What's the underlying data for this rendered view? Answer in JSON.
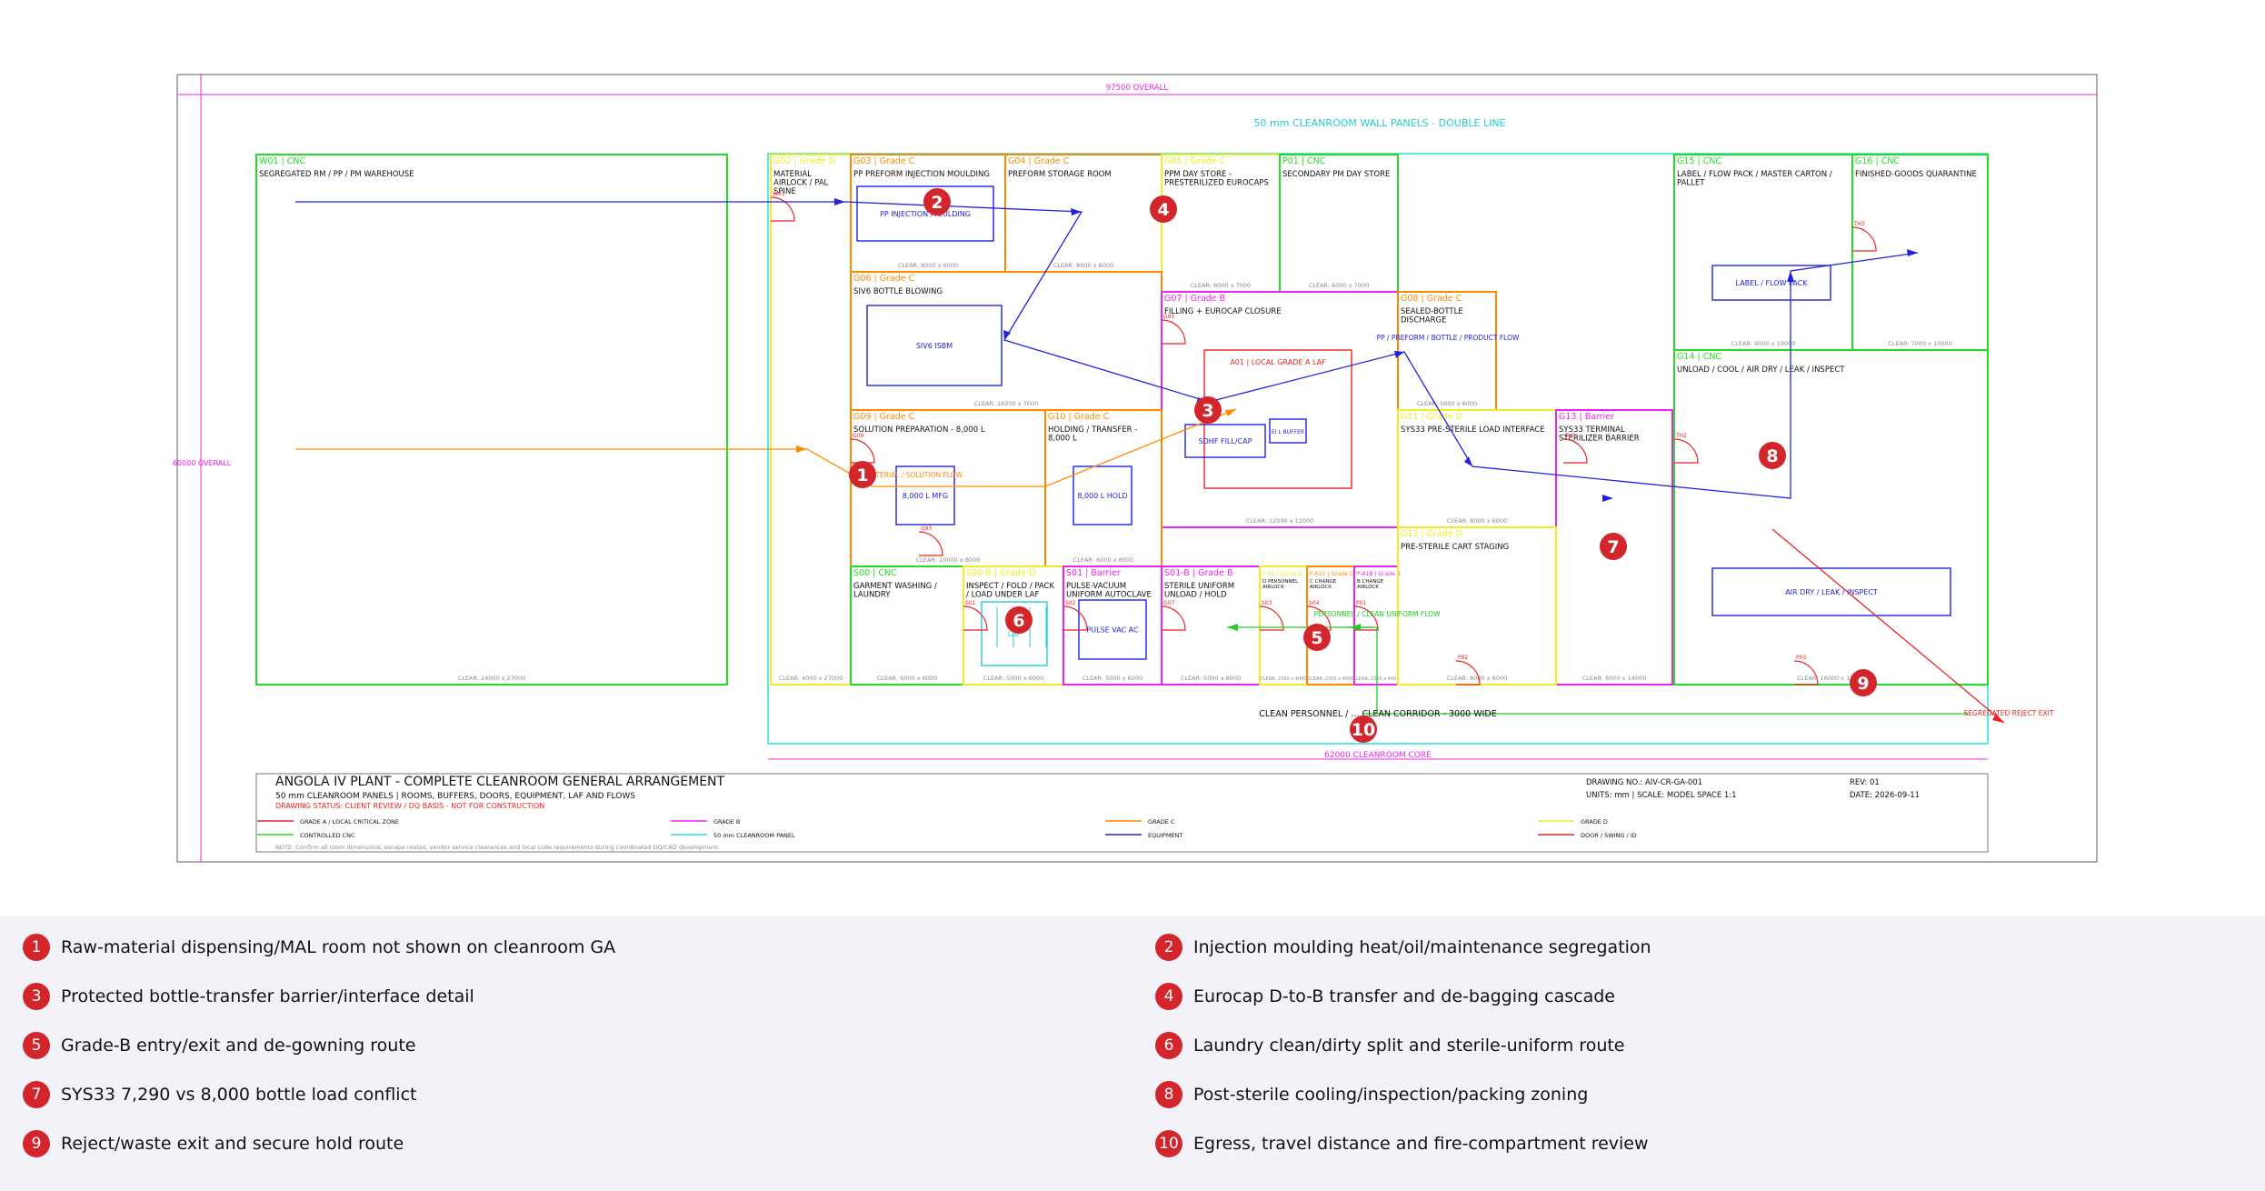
{
  "drawing": {
    "dimensions": {
      "overall_width": "97500 OVERALL",
      "overall_height": "60000 OVERALL",
      "core": "62000 CLEANROOM CORE"
    },
    "wall_panels_label": "50 mm CLEANROOM WALL PANELS - DOUBLE LINE",
    "rooms": [
      {
        "id": "W01",
        "head": "W01 | CNC",
        "name": [
          "SEGREGATED RM / PP / PM WAREHOUSE"
        ],
        "clear": "CLEAR: 24000 x 27000",
        "color": "#22dd22"
      },
      {
        "id": "MAL",
        "head": "G02 | Grade D",
        "name": [
          "MATERIAL",
          "AIRLOCK / PAL",
          "SPINE"
        ],
        "clear": "CLEAR: 4000 x 27000",
        "color": "#eeee22"
      },
      {
        "id": "G03",
        "head": "G03 | Grade C",
        "name": [
          "PP PREFORM INJECTION MOULDING"
        ],
        "clear": "CLEAR: 8000 x 6000",
        "color": "#ff8a00"
      },
      {
        "id": "G04",
        "head": "G04 | Grade C",
        "name": [
          "PREFORM STORAGE ROOM"
        ],
        "clear": "CLEAR: 8000 x 6000",
        "color": "#ff8a00"
      },
      {
        "id": "G05",
        "head": "G05 | Grade C",
        "name": [
          "PPM DAY STORE -",
          "PRESTERILIZED EUROCAPS"
        ],
        "clear": "CLEAR: 6000 x 7000",
        "color": "#eeee22"
      },
      {
        "id": "P01",
        "head": "P01 | CNC",
        "name": [
          "SECONDARY PM DAY STORE"
        ],
        "clear": "CLEAR: 6000 x 7000",
        "color": "#22dd22"
      },
      {
        "id": "G06",
        "head": "G06 | Grade C",
        "name": [
          "SIV6 BOTTLE BLOWING"
        ],
        "clear": "CLEAR: 16000 x 7000",
        "color": "#ff8a00"
      },
      {
        "id": "G07",
        "head": "G07 | Grade B",
        "name": [
          "FILLING + EUROCAP CLOSURE"
        ],
        "clear": "CLEAR: 12000 x 12000",
        "color": "#ee22ee"
      },
      {
        "id": "G08",
        "head": "G08 | Grade C",
        "name": [
          "SEALED-BOTTLE",
          "DISCHARGE"
        ],
        "clear": "CLEAR: 5000 x 6000",
        "color": "#ff8a00"
      },
      {
        "id": "G09",
        "head": "G09 | Grade C",
        "name": [
          "SOLUTION PREPARATION - 8,000 L"
        ],
        "clear": "CLEAR: 10000 x 8000",
        "color": "#ff8a00"
      },
      {
        "id": "G10",
        "head": "G10 | Grade C",
        "name": [
          "HOLDING / TRANSFER -",
          "8,000 L"
        ],
        "clear": "CLEAR: 6000 x 8000",
        "color": "#ff8a00"
      },
      {
        "id": "SYS",
        "head": "G11 | Grade D",
        "name": [
          "SYS33 PRE-STERILE LOAD INTERFACE"
        ],
        "clear": "CLEAR: 8000 x 6000",
        "color": "#eeee22"
      },
      {
        "id": "G13",
        "head": "G13 | Barrier",
        "name": [
          "SYS33 TERMINAL",
          "STERILIZER BARRIER"
        ],
        "clear": "CLEAR: 6000 x 14000",
        "color": "#ee22ee"
      },
      {
        "id": "G15",
        "head": "G15 | CNC",
        "name": [
          "LABEL / FLOW PACK / MASTER CARTON /",
          "PALLET"
        ],
        "clear": "CLEAR: 9000 x 10000",
        "color": "#22dd22"
      },
      {
        "id": "G16",
        "head": "G16 | CNC",
        "name": [
          "FINISHED-GOODS QUARANTINE"
        ],
        "clear": "CLEAR: 7000 x 10000",
        "color": "#22dd22"
      },
      {
        "id": "G14",
        "head": "G14 | CNC",
        "name": [
          "UNLOAD / COOL / AIR DRY / LEAK / INSPECT"
        ],
        "clear": "CLEAR: 16000 x 17000",
        "color": "#22dd22"
      },
      {
        "id": "S00",
        "head": "S00 | CNC",
        "name": [
          "GARMENT WASHING /",
          "LAUNDRY"
        ],
        "clear": "CLEAR: 6000 x 6000",
        "color": "#22dd22"
      },
      {
        "id": "INS",
        "head": "S00-B | Grade D",
        "name": [
          "INSPECT / FOLD / PACK",
          "/ LOAD UNDER LAF"
        ],
        "clear": "CLEAR: 5000 x 6000",
        "color": "#eeee22"
      },
      {
        "id": "S01",
        "head": "S01 | Barrier",
        "name": [
          "PULSE-VACUUM",
          "UNIFORM AUTOCLAVE"
        ],
        "clear": "CLEAR: 5000 x 6000",
        "color": "#ee22ee"
      },
      {
        "id": "S01B",
        "head": "S01-B | Grade B",
        "name": [
          "STERILE UNIFORM",
          "UNLOAD / HOLD"
        ],
        "clear": "CLEAR: 5000 x 6000",
        "color": "#ee22ee"
      },
      {
        "id": "PA1",
        "head": "P-A1 | Grade D",
        "name": [
          "D PERSONNEL",
          "AIRLOCK"
        ],
        "clear": "CLEAR: 2350 x 4000",
        "color": "#eeee22"
      },
      {
        "id": "PA2",
        "head": "P-A1C | Grade C",
        "name": [
          "C CHANGE",
          "AIRLOCK"
        ],
        "clear": "CLEAR: 2350 x 4000",
        "color": "#ff8a00"
      },
      {
        "id": "PA3",
        "head": "P-A1B | Grade B",
        "name": [
          "B CHANGE",
          "AIRLOCK"
        ],
        "clear": "CLEAR: 2350 x 4000",
        "color": "#ee22ee"
      },
      {
        "id": "PST",
        "head": "G12 | Grade D",
        "name": [
          "PRE-STERILE CART STAGING"
        ],
        "clear": "CLEAR: 8000 x 8000",
        "color": "#eeee22"
      }
    ],
    "equipment": [
      {
        "id": "e_pp",
        "label": "PP INJECTION MOULDING"
      },
      {
        "id": "e_sib",
        "label": "SIV6 ISBM"
      },
      {
        "id": "e_a01",
        "label": "A01 | LOCAL GRADE A LAF"
      },
      {
        "id": "e_fill",
        "label": "SDHF FILL/CAP"
      },
      {
        "id": "e_buf",
        "label": "EI L BUFFER"
      },
      {
        "id": "e_mfg",
        "label": "8,000 L MFG"
      },
      {
        "id": "e_hold",
        "label": "8,000 L HOLD"
      },
      {
        "id": "e_lbl",
        "label": "LABEL / FLOW PACK"
      },
      {
        "id": "e_air",
        "label": "AIR DRY / LEAK / INSPECT"
      },
      {
        "id": "e_pulse",
        "label": "PULSE VAC AC"
      },
      {
        "id": "e_laf",
        "label": "LAF"
      }
    ],
    "flow_labels": {
      "raw_material": "RAW MATERIAL / SOLUTION FLOW",
      "pp_preform": "PP / PREFORM / BOTTLE / PRODUCT FLOW",
      "personnel": "PERSONNEL / CLEAN UNIFORM FLOW",
      "corridor": "CLEAN PERSONNEL / ... CLEAN CORRIDOR - 3000 WIDE",
      "reject": "SEGREGATED REJECT EXIT"
    },
    "doors": [
      "W01",
      "G03",
      "G05",
      "G07",
      "G09",
      "TH1",
      "TH2",
      "TH3",
      "S01",
      "S02",
      "S03",
      "S04",
      "P01",
      "P02",
      "P03"
    ],
    "title_block": {
      "title": "ANGOLA IV PLANT - COMPLETE CLEANROOM GENERAL ARRANGEMENT",
      "subtitle": "50 mm CLEANROOM PANELS | ROOMS, BUFFERS, DOORS, EQUIPMENT, LAF AND FLOWS",
      "status": "DRAWING STATUS: CLIENT REVIEW / DQ BASIS - NOT FOR CONSTRUCTION",
      "drawing_no": "DRAWING NO.: AIV-CR-GA-001",
      "units": "UNITS: mm | SCALE: MODEL SPACE 1:1",
      "rev": "REV: 01",
      "date": "DATE: 2026-09-11",
      "note": "NOTE: Confirm all room dimensions, escape routes, vendor service clearances and local code requirements during coordinated DQ/CAD development."
    },
    "legend": [
      {
        "label": "GRADE A / LOCAL CRITICAL ZONE",
        "color": "#ee2222"
      },
      {
        "label": "CONTROLLED CNC",
        "color": "#22dd22"
      },
      {
        "label": "GRADE B",
        "color": "#ee22ee"
      },
      {
        "label": "50 mm CLEANROOM PANEL",
        "color": "#22dddd"
      },
      {
        "label": "GRADE C",
        "color": "#ff8a00"
      },
      {
        "label": "EQUIPMENT",
        "color": "#2222cc"
      },
      {
        "label": "GRADE D",
        "color": "#eeee22"
      },
      {
        "label": "DOOR / SWING / ID",
        "color": "#ee2222"
      }
    ],
    "markers": [
      "1",
      "2",
      "3",
      "4",
      "5",
      "6",
      "7",
      "8",
      "9",
      "10"
    ]
  },
  "notes": [
    {
      "num": "1",
      "text": "Raw-material dispensing/MAL room not shown on cleanroom GA"
    },
    {
      "num": "2",
      "text": "Injection moulding heat/oil/maintenance segregation"
    },
    {
      "num": "3",
      "text": "Protected bottle-transfer barrier/interface detail"
    },
    {
      "num": "4",
      "text": "Eurocap D-to-B transfer and de-bagging cascade"
    },
    {
      "num": "5",
      "text": "Grade-B entry/exit and de-gowning route"
    },
    {
      "num": "6",
      "text": "Laundry clean/dirty split and sterile-uniform route"
    },
    {
      "num": "7",
      "text": "SYS33 7,290 vs 8,000 bottle load conflict"
    },
    {
      "num": "8",
      "text": "Post-sterile cooling/inspection/packing zoning"
    },
    {
      "num": "9",
      "text": "Reject/waste exit and secure hold route"
    },
    {
      "num": "10",
      "text": "Egress, travel distance and fire-compartment review"
    }
  ]
}
